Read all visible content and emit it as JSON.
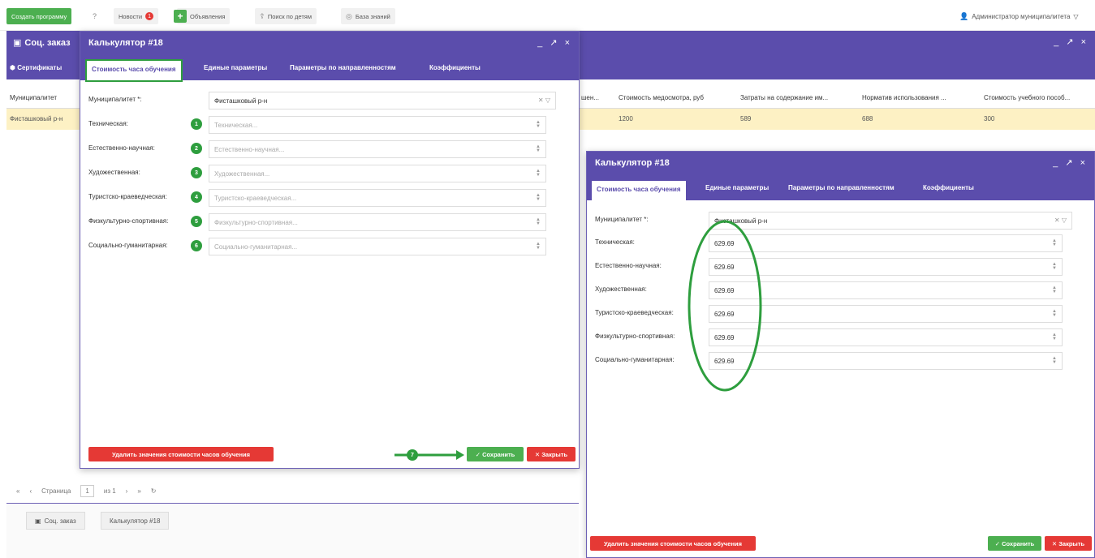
{
  "toolbar": {
    "create_program": "Создать программу",
    "help_icon": "?",
    "news": "Новости",
    "news_badge": "1",
    "ads": "Объявления",
    "child_search": "Поиск по детям",
    "knowledge_base": "База знаний",
    "user": "Администратор муниципалитета",
    "user_caret": "▽"
  },
  "background": {
    "title": "Соц. заказ",
    "window_controls": "_ ↗ ×",
    "tab": "Сертификаты",
    "columns": [
      "Муниципалитет",
      "шен...",
      "Стоимость медосмотра, руб",
      "Затраты на содержание им...",
      "Норматив использования ...",
      "Стоимость учебного пособ..."
    ],
    "row": [
      "Фисташковый р-н",
      "",
      "1200",
      "589",
      "688",
      "300"
    ],
    "pager": {
      "page_label": "Страница",
      "page": "1",
      "of": "из 1"
    },
    "bottom_tabs": [
      "Соц. заказ",
      "Калькулятор #18"
    ]
  },
  "dialog1": {
    "title": "Калькулятор #18",
    "window_controls": "_ ↗ ×",
    "tabs": [
      "Стоимость часа обучения",
      "Единые параметры",
      "Параметры по направленностям",
      "Коэффициенты"
    ],
    "municipality_label": "Муниципалитет *:",
    "municipality_value": "Фисташковый р-н",
    "fields": [
      {
        "label": "Техническая:",
        "placeholder": "Техническая...",
        "num": "1"
      },
      {
        "label": "Естественно-научная:",
        "placeholder": "Естественно-научная...",
        "num": "2"
      },
      {
        "label": "Художественная:",
        "placeholder": "Художественная...",
        "num": "3"
      },
      {
        "label": "Туристско-краеведческая:",
        "placeholder": "Туристско-краеведческая...",
        "num": "4"
      },
      {
        "label": "Физкультурно-спортивная:",
        "placeholder": "Физкультурно-спортивная...",
        "num": "5"
      },
      {
        "label": "Социально-гуманитарная:",
        "placeholder": "Социально-гуманитарная...",
        "num": "6"
      }
    ],
    "delete_button": "Удалить значения стоимости часов обучения",
    "step7": "7",
    "save_button": "✓ Сохранить",
    "close_button": "✕ Закрыть"
  },
  "dialog2": {
    "title": "Калькулятор #18",
    "window_controls": "_ ↗ ×",
    "tabs": [
      "Стоимость часа обучения",
      "Единые параметры",
      "Параметры по направленностям",
      "Коэффициенты"
    ],
    "municipality_label": "Муниципалитет *:",
    "municipality_value": "Фисташковый р-н",
    "fields": [
      {
        "label": "Техническая:",
        "value": "629.69"
      },
      {
        "label": "Естественно-научная:",
        "value": "629.69"
      },
      {
        "label": "Художественная:",
        "value": "629.69"
      },
      {
        "label": "Туристско-краеведческая:",
        "value": "629.69"
      },
      {
        "label": "Физкультурно-спортивная:",
        "value": "629.69"
      },
      {
        "label": "Социально-гуманитарная:",
        "value": "629.69"
      }
    ],
    "delete_button": "Удалить значения стоимости часов обучения",
    "save_button": "✓ Сохранить",
    "close_button": "✕ Закрыть"
  },
  "colors": {
    "header": "#5b4dac",
    "highlight": "#2e9e3e",
    "row": "#fdf1c4",
    "danger": "#e53935"
  }
}
